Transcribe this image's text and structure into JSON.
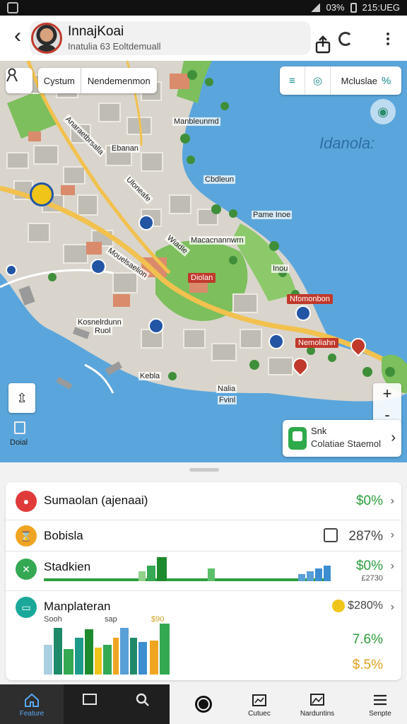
{
  "status": {
    "time": "215:UEG",
    "battery": "03%"
  },
  "header": {
    "name": "InnajKoai",
    "subtitle": "Inatulia 63 Eoltdemuall"
  },
  "map": {
    "chip_left": "Cystum",
    "chip_right": "Nendemenmon",
    "tool_label": "Mcluslae",
    "sea_label": "Idanola:",
    "labels": [
      "Manbleunmd",
      "Ebanan",
      "Cbdleun",
      "Pame Inoe",
      "Macacnannwrn",
      "Inou",
      "Diolan",
      "Nfomonbon",
      "Nemoliahn",
      "Kebla",
      "Nalia",
      "Fvinl",
      "Anaraetbrsalla",
      "Uloneafe",
      "Mouelsaelion",
      "Kosnelrdunn",
      "Ruol",
      "Wiadle"
    ],
    "scale_label": "Doial",
    "stop_title": "Snk",
    "stop_sub": "Colatiae Staemol",
    "zoom_in": "+",
    "zoom_out": "-"
  },
  "list": [
    {
      "label": "Sumaolan (ajenaai)",
      "value": "$0%",
      "value_color": "#2e9e3e",
      "icon_color": "#e03a3a",
      "icon": "lock-icon"
    },
    {
      "label": "Bobisla",
      "value": "287%",
      "value_color": "#444444",
      "icon_color": "#f0a522",
      "icon": "hourglass-icon"
    },
    {
      "label": "Stadkien",
      "value": "$0%",
      "sub": "£2730",
      "value_color": "#2e9e3e",
      "icon_color": "#34a853",
      "icon": "tools-icon"
    },
    {
      "label": "Manplateran",
      "value": "$280%",
      "value2": "7.6%",
      "value3": "$.5%",
      "value_color": "#444444",
      "icon_color": "#1aa89a",
      "icon": "chat-icon",
      "axis_left": "Sooh",
      "axis_mid": "sap",
      "axis_right": "$90"
    }
  ],
  "nav": [
    {
      "label": "Feature",
      "icon": "home-icon"
    },
    {
      "label": "",
      "icon": "chat-icon"
    },
    {
      "label": "",
      "icon": "search-icon"
    },
    {
      "label": "",
      "icon": "record-icon"
    },
    {
      "label": "Cutuec",
      "icon": "calendar-icon"
    },
    {
      "label": "Narduntins",
      "icon": "gallery-icon"
    },
    {
      "label": "Senpte",
      "icon": "menu-icon"
    }
  ]
}
